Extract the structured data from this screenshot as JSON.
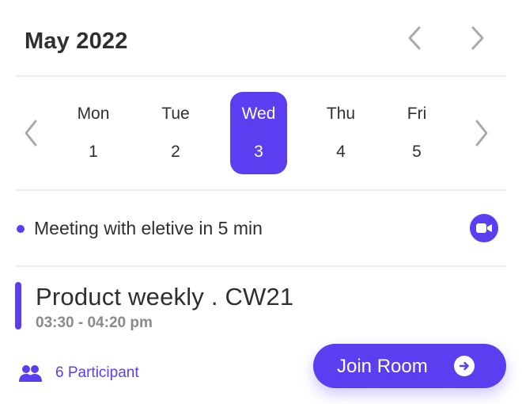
{
  "header": {
    "month_title": "May 2022",
    "prev_month_icon": "chevron-left-icon",
    "next_month_icon": "chevron-right-icon"
  },
  "week": {
    "prev_week_icon": "chevron-left-icon",
    "next_week_icon": "chevron-right-icon",
    "days": [
      {
        "name": "Mon",
        "number": "1",
        "selected": false
      },
      {
        "name": "Tue",
        "number": "2",
        "selected": false
      },
      {
        "name": "Wed",
        "number": "3",
        "selected": true
      },
      {
        "name": "Thu",
        "number": "4",
        "selected": false
      },
      {
        "name": "Fri",
        "number": "5",
        "selected": false
      }
    ]
  },
  "reminder": {
    "text": "Meeting with eletive in 5 min",
    "icon": "video-camera-icon"
  },
  "event": {
    "title": "Product weekly . CW21",
    "time": "03:30 - 04:20 pm",
    "participants_label": "6 Participant",
    "participants_icon": "users-icon",
    "join_label": "Join Room",
    "join_icon": "arrow-right-circle-icon"
  },
  "colors": {
    "accent": "#5b3ef0",
    "text": "#2f2f2f",
    "muted": "#8a8a8a",
    "divider": "#ececec",
    "chevron": "#a9a9a9"
  }
}
